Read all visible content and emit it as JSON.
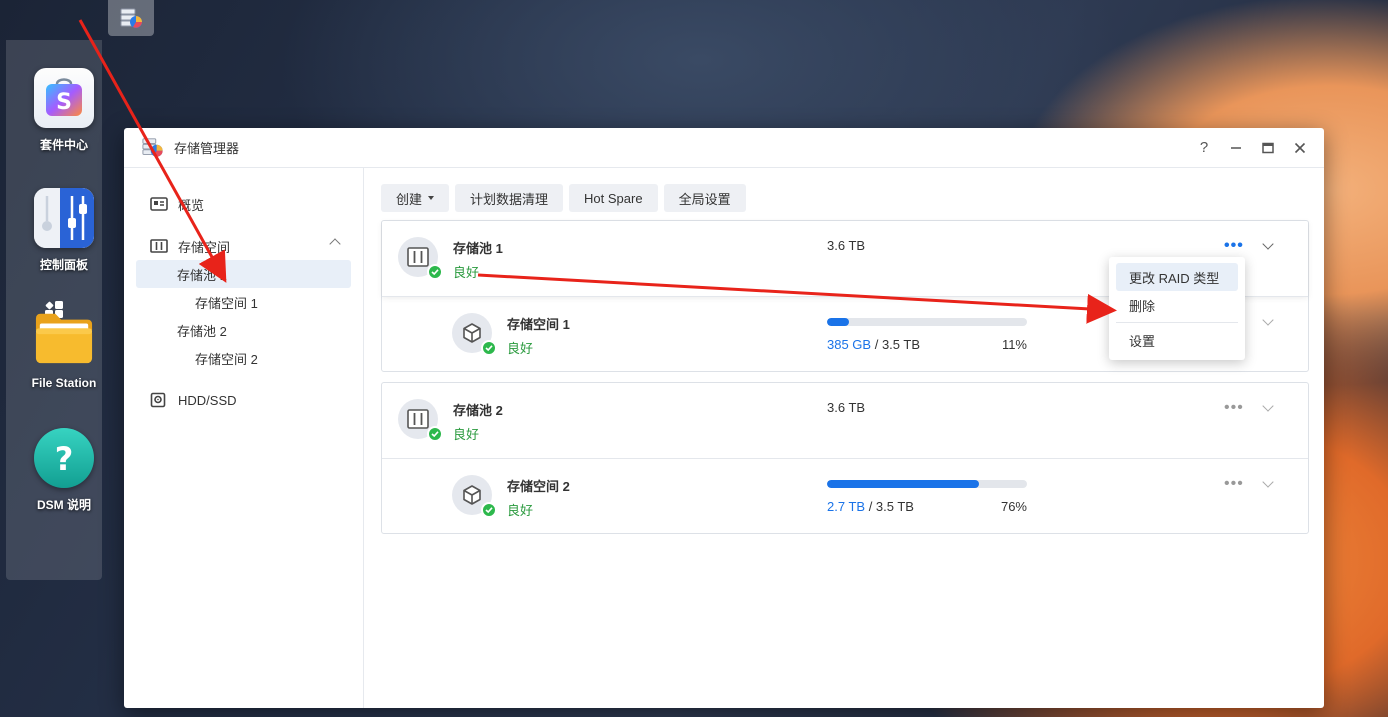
{
  "desktop": {
    "icons": [
      {
        "label": "套件中心"
      },
      {
        "label": "控制面板"
      },
      {
        "label": "File Station"
      },
      {
        "label": "DSM 说明"
      }
    ]
  },
  "window": {
    "title": "存储管理器",
    "help_glyph": "?"
  },
  "sidebar": {
    "overview": "概览",
    "storage": "存储空间",
    "pool1": "存储池 1",
    "volume1": "存储空间 1",
    "pool2": "存储池 2",
    "volume2": "存储空间 2",
    "hdd": "HDD/SSD"
  },
  "toolbar": {
    "create": "创建",
    "scrub": "计划数据清理",
    "hotspare": "Hot Spare",
    "global": "全局设置"
  },
  "pools": [
    {
      "name": "存储池 1",
      "status": "良好",
      "size": "3.6 TB",
      "volume": {
        "name": "存储空间 1",
        "status": "良好",
        "used": "385 GB",
        "total": "/ 3.5 TB",
        "percent": "11%",
        "fill": 0.11
      }
    },
    {
      "name": "存储池 2",
      "status": "良好",
      "size": "3.6 TB",
      "volume": {
        "name": "存储空间 2",
        "status": "良好",
        "used": "2.7 TB",
        "total": "/ 3.5 TB",
        "percent": "76%",
        "fill": 0.76
      }
    }
  ],
  "menu": {
    "change_raid": "更改 RAID 类型",
    "delete": "删除",
    "settings": "设置"
  },
  "colors": {
    "accent": "#1a73e8",
    "healthy": "#2a9a3e",
    "annotation": "#e8231a"
  }
}
